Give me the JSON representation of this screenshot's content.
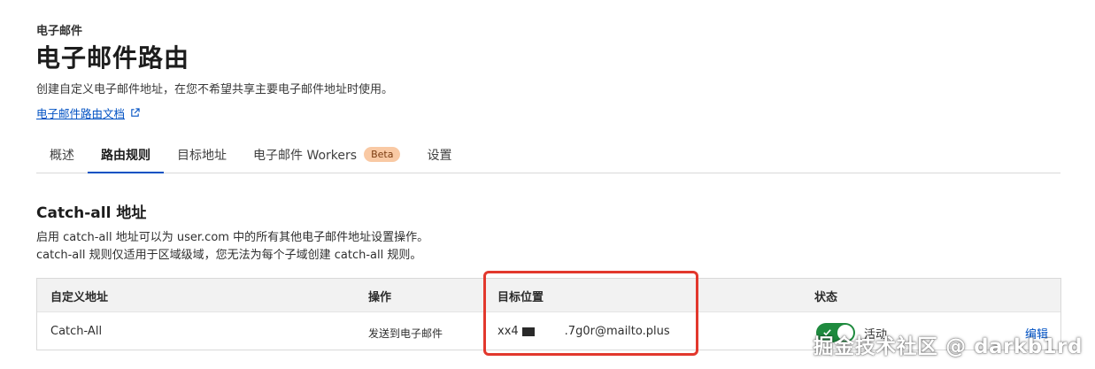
{
  "header": {
    "section_label": "电子邮件",
    "title": "电子邮件路由",
    "description": "创建自定义电子邮件地址，在您不希望共享主要电子邮件地址时使用。",
    "doc_link": "电子邮件路由文档"
  },
  "tabs": [
    {
      "label": "概述",
      "active": false
    },
    {
      "label": "路由规则",
      "active": true
    },
    {
      "label": "目标地址",
      "active": false
    },
    {
      "label": "电子邮件 Workers",
      "active": false,
      "badge": "Beta"
    },
    {
      "label": "设置",
      "active": false
    }
  ],
  "catch_all": {
    "title": "Catch-all 地址",
    "description_line1": "启用 catch-all 地址可以为 user.com 中的所有其他电子邮件地址设置操作。",
    "description_line2": "catch-all 规则仅适用于区域级域，您无法为每个子域创建 catch-all 规则。"
  },
  "table": {
    "headers": [
      "自定义地址",
      "操作",
      "目标位置",
      "状态"
    ],
    "row": {
      "custom_address": "Catch-All",
      "action": "发送到电子邮件",
      "destination_prefix": "xx4",
      "destination_suffix": ".7g0r@mailto.plus",
      "status": "活动",
      "status_enabled": true,
      "edit": "编辑"
    }
  },
  "watermark": "掘金技术社区 @ darkb1rd",
  "colors": {
    "accent": "#0051c3",
    "toggle_on": "#1e8a3e",
    "highlight_border": "#e2382d",
    "badge_bg": "#f9c9a4"
  }
}
